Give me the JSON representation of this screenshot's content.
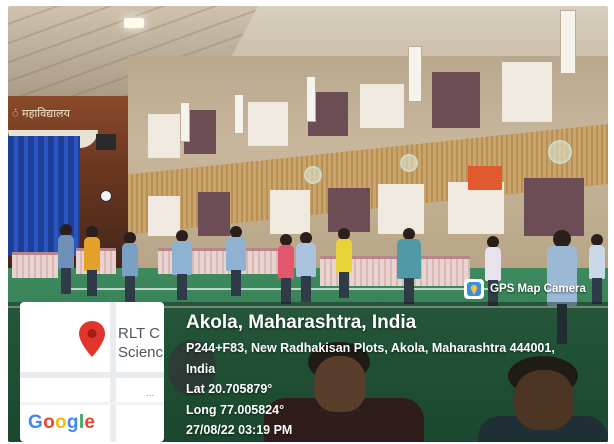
{
  "overlay": {
    "app_badge": "GPS Map Camera",
    "location_title": "Akola, Maharashtra, India",
    "address_line1": "P244+F83, New Radhakisan Plots, Akola, Maharashtra 444001,",
    "address_line2": "India",
    "latitude": "Lat 20.705879°",
    "longitude": "Long 77.005824°",
    "datetime": "27/08/22 03:19 PM"
  },
  "map": {
    "place_line1": "RLT C",
    "place_line2": "Scienc",
    "more": "...",
    "provider_letters": [
      "G",
      "o",
      "o",
      "g",
      "l",
      "e"
    ]
  },
  "scene": {
    "wall_sign": "ं महाविद्यालय"
  },
  "colors": {
    "floor_green": "#2e7a4e",
    "curtain_blue": "#1d3f9a",
    "map_pin_red": "#e2352b",
    "overlay_text": "#ffffff"
  },
  "icons": [
    "map-pin-icon",
    "gps-map-camera-icon"
  ]
}
